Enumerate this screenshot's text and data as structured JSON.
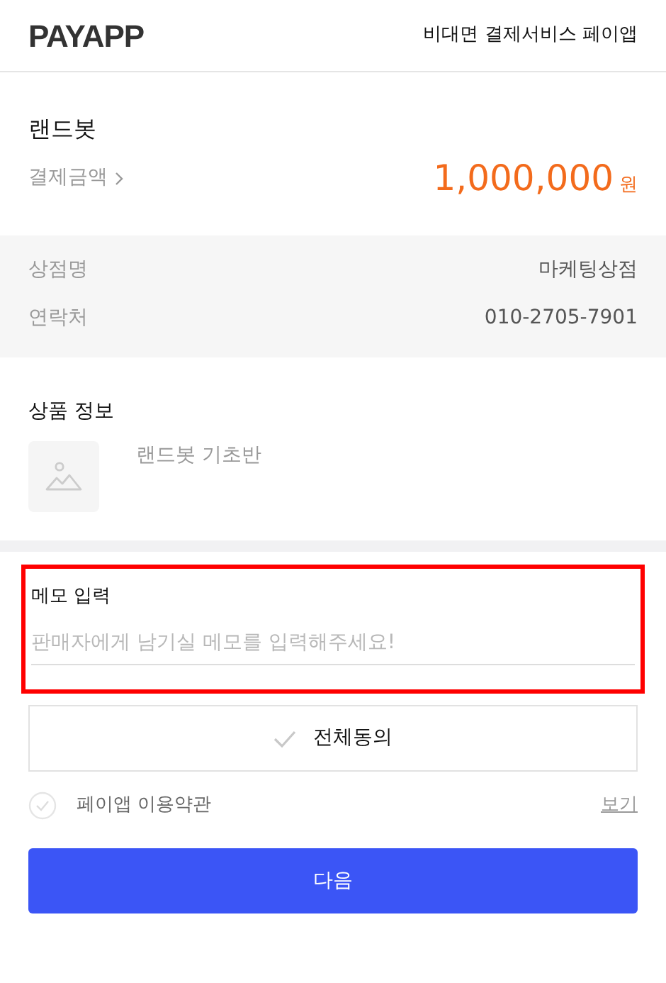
{
  "header": {
    "logo": "PAYAPP",
    "tagline": "비대면 결제서비스 페이앱"
  },
  "order": {
    "seller_title": "랜드봇",
    "amount_label": "결제금액",
    "amount": "1,000,000",
    "currency": "원"
  },
  "store_info": [
    {
      "label": "상점명",
      "value": "마케팅상점"
    },
    {
      "label": "연락처",
      "value": "010-2705-7901"
    }
  ],
  "product": {
    "heading": "상품 정보",
    "name": "랜드봇 기초반"
  },
  "memo": {
    "label": "메모 입력",
    "placeholder": "판매자에게 남기실 메모를 입력해주세요!",
    "highlighted": true
  },
  "agree_all": {
    "label": "전체동의",
    "checked": false
  },
  "terms": [
    {
      "label": "페이앱 이용약관",
      "checked": false,
      "link": "보기"
    }
  ],
  "next_button": "다음"
}
